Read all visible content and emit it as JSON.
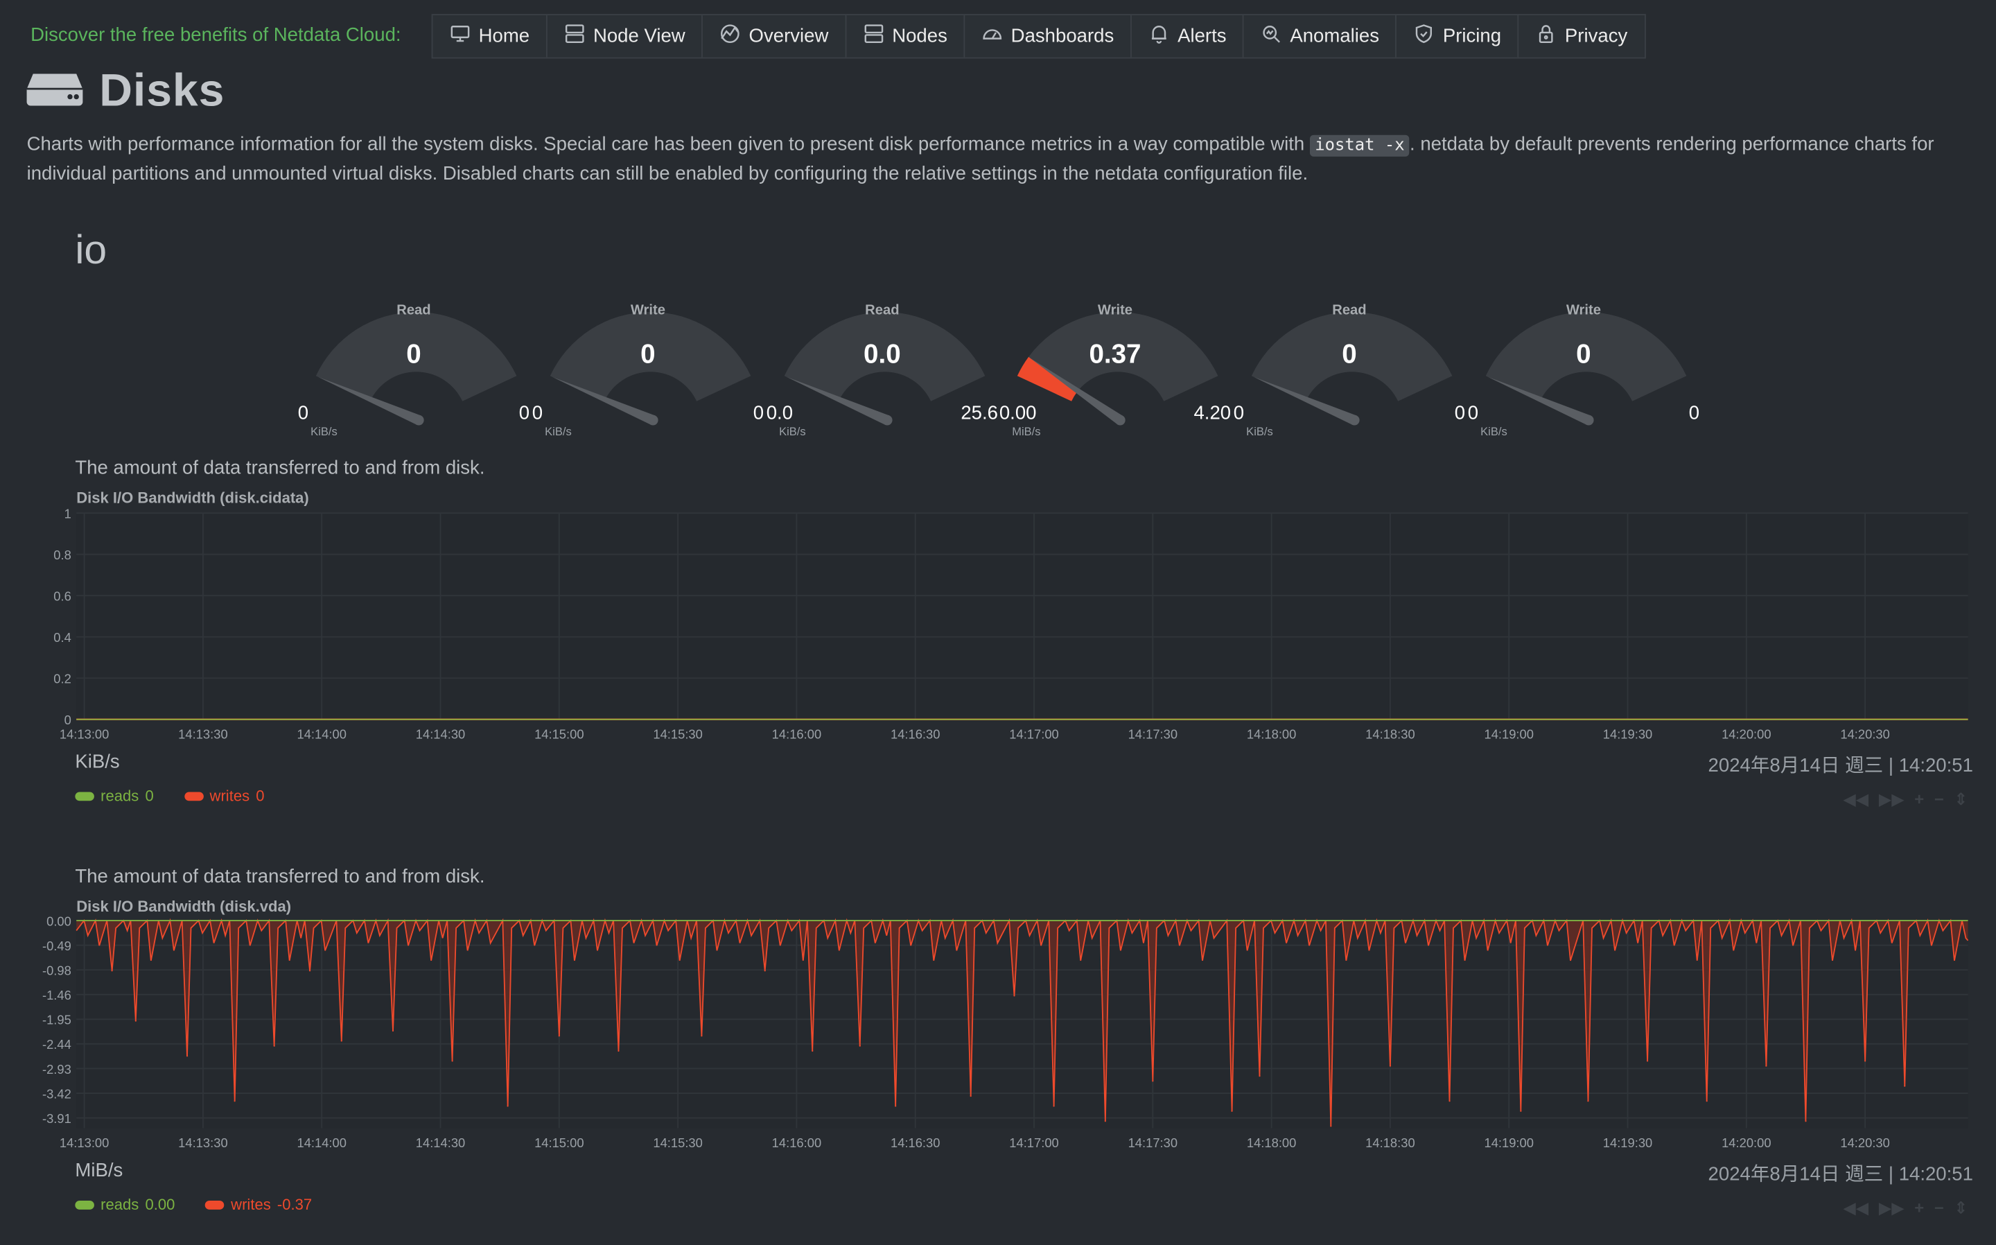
{
  "header": {
    "promo": "Discover the free benefits of Netdata Cloud:",
    "nav": [
      {
        "label": "Home",
        "icon": "monitor-icon"
      },
      {
        "label": "Node View",
        "icon": "server-icon"
      },
      {
        "label": "Overview",
        "icon": "overview-icon"
      },
      {
        "label": "Nodes",
        "icon": "nodes-icon"
      },
      {
        "label": "Dashboards",
        "icon": "dashboard-icon"
      },
      {
        "label": "Alerts",
        "icon": "bell-icon"
      },
      {
        "label": "Anomalies",
        "icon": "anomaly-search-icon"
      },
      {
        "label": "Pricing",
        "icon": "shield-icon"
      },
      {
        "label": "Privacy",
        "icon": "lock-icon"
      }
    ]
  },
  "section": {
    "title": "Disks",
    "icon": "hard-drive-icon",
    "intro_before": "Charts with performance information for all the system disks. Special care has been given to present disk performance metrics in a way compatible with ",
    "intro_code": "iostat -x",
    "intro_after": ". netdata by default prevents rendering performance charts for individual partitions and unmounted virtual disks. Disabled charts can still be enabled by configuring the relative settings in the netdata configuration file.",
    "subsection": "io"
  },
  "gauges": [
    {
      "label": "Read",
      "value": "0",
      "min": "0",
      "max": "0",
      "unit": "KiB/s",
      "fraction": 0,
      "color": "#54575b"
    },
    {
      "label": "Write",
      "value": "0",
      "min": "0",
      "max": "0",
      "unit": "KiB/s",
      "fraction": 0,
      "color": "#54575b"
    },
    {
      "label": "Read",
      "value": "0.0",
      "min": "0.0",
      "max": "25.6",
      "unit": "KiB/s",
      "fraction": 0,
      "color": "#54575b"
    },
    {
      "label": "Write",
      "value": "0.37",
      "min": "0.00",
      "max": "4.20",
      "unit": "MiB/s",
      "fraction": 0.088,
      "color": "#ee4a2c"
    },
    {
      "label": "Read",
      "value": "0",
      "min": "0",
      "max": "0",
      "unit": "KiB/s",
      "fraction": 0,
      "color": "#54575b"
    },
    {
      "label": "Write",
      "value": "0",
      "min": "0",
      "max": "0",
      "unit": "KiB/s",
      "fraction": 0,
      "color": "#54575b"
    }
  ],
  "charts": [
    {
      "description": "The amount of data transferred to and from disk.",
      "title": "Disk I/O Bandwidth (disk.cidata)",
      "unit": "KiB/s",
      "date": "2024年8月14日 週三 | 14:20:51",
      "legend": [
        {
          "name": "reads",
          "value": "0",
          "color": "#7cb342"
        },
        {
          "name": "writes",
          "value": "0",
          "color": "#ee4a2c"
        }
      ]
    },
    {
      "description": "The amount of data transferred to and from disk.",
      "title": "Disk I/O Bandwidth (disk.vda)",
      "unit": "MiB/s",
      "date": "2024年8月14日 週三 | 14:20:51",
      "legend": [
        {
          "name": "reads",
          "value": "0.00",
          "color": "#7cb342"
        },
        {
          "name": "writes",
          "value": "-0.37",
          "color": "#ee4a2c"
        }
      ]
    }
  ],
  "chart_data": [
    {
      "type": "line",
      "title": "Disk I/O Bandwidth (disk.cidata)",
      "ylabel": "KiB/s",
      "ylim": [
        0,
        1
      ],
      "yticks": [
        "1",
        "0.8",
        "0.6",
        "0.4",
        "0.2",
        "0"
      ],
      "xticks": [
        "14:13:00",
        "14:13:30",
        "14:14:00",
        "14:14:30",
        "14:15:00",
        "14:15:30",
        "14:16:00",
        "14:16:30",
        "14:17:00",
        "14:17:30",
        "14:18:00",
        "14:18:30",
        "14:19:00",
        "14:19:30",
        "14:20:00",
        "14:20:30"
      ],
      "series": [
        {
          "name": "reads",
          "values": "constant 0"
        },
        {
          "name": "writes",
          "values": "constant 0"
        }
      ],
      "grid": true
    },
    {
      "type": "area",
      "title": "Disk I/O Bandwidth (disk.vda)",
      "ylabel": "MiB/s",
      "ylim": [
        -4.14,
        0
      ],
      "yticks": [
        "0.00",
        "-0.49",
        "-0.98",
        "-1.46",
        "-1.95",
        "-2.44",
        "-2.93",
        "-3.42",
        "-3.91"
      ],
      "xticks": [
        "14:13:00",
        "14:13:30",
        "14:14:00",
        "14:14:30",
        "14:15:00",
        "14:15:30",
        "14:16:00",
        "14:16:30",
        "14:17:00",
        "14:17:30",
        "14:18:00",
        "14:18:30",
        "14:19:00",
        "14:19:30",
        "14:20:00",
        "14:20:30"
      ],
      "spikes": [
        {
          "t": "14:13:07",
          "v": -1.0
        },
        {
          "t": "14:13:13",
          "v": -2.0
        },
        {
          "t": "14:13:26",
          "v": -2.7
        },
        {
          "t": "14:13:38",
          "v": -3.6
        },
        {
          "t": "14:13:48",
          "v": -2.5
        },
        {
          "t": "14:13:57",
          "v": -1.0
        },
        {
          "t": "14:14:05",
          "v": -2.4
        },
        {
          "t": "14:14:18",
          "v": -2.2
        },
        {
          "t": "14:14:33",
          "v": -2.8
        },
        {
          "t": "14:14:47",
          "v": -3.7
        },
        {
          "t": "14:15:00",
          "v": -2.3
        },
        {
          "t": "14:15:15",
          "v": -2.6
        },
        {
          "t": "14:15:36",
          "v": -2.3
        },
        {
          "t": "14:15:52",
          "v": -1.0
        },
        {
          "t": "14:16:04",
          "v": -2.6
        },
        {
          "t": "14:16:16",
          "v": -2.5
        },
        {
          "t": "14:16:25",
          "v": -3.7
        },
        {
          "t": "14:16:44",
          "v": -3.5
        },
        {
          "t": "14:16:55",
          "v": -1.5
        },
        {
          "t": "14:17:05",
          "v": -3.7
        },
        {
          "t": "14:17:18",
          "v": -4.0
        },
        {
          "t": "14:17:30",
          "v": -3.2
        },
        {
          "t": "14:17:50",
          "v": -3.8
        },
        {
          "t": "14:17:57",
          "v": -3.1
        },
        {
          "t": "14:18:15",
          "v": -4.1
        },
        {
          "t": "14:18:30",
          "v": -2.9
        },
        {
          "t": "14:18:45",
          "v": -3.6
        },
        {
          "t": "14:19:03",
          "v": -3.8
        },
        {
          "t": "14:19:20",
          "v": -3.6
        },
        {
          "t": "14:19:35",
          "v": -2.8
        },
        {
          "t": "14:19:50",
          "v": -3.6
        },
        {
          "t": "14:20:05",
          "v": -2.9
        },
        {
          "t": "14:20:15",
          "v": -4.0
        },
        {
          "t": "14:20:30",
          "v": -2.8
        },
        {
          "t": "14:20:40",
          "v": -3.3
        }
      ],
      "series": [
        {
          "name": "reads",
          "values": "constant 0.00"
        },
        {
          "name": "writes",
          "values": "negative spikes listed in spikes"
        }
      ],
      "grid": true
    }
  ]
}
